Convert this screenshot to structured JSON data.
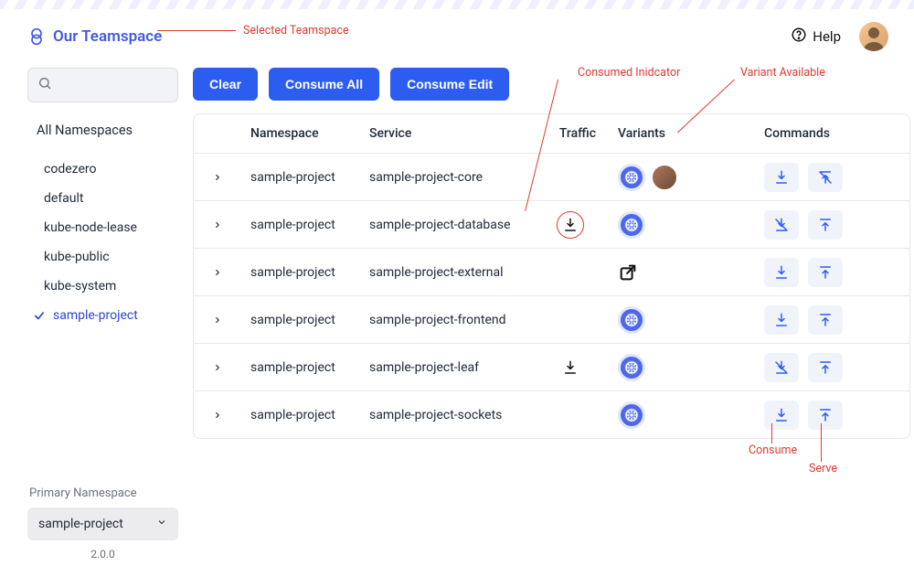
{
  "header": {
    "teamspace_name": "Our Teamspace",
    "help_label": "Help"
  },
  "sidebar": {
    "search_placeholder": "",
    "all_label": "All Namespaces",
    "items": [
      {
        "label": "codezero",
        "selected": false
      },
      {
        "label": "default",
        "selected": false
      },
      {
        "label": "kube-node-lease",
        "selected": false
      },
      {
        "label": "kube-public",
        "selected": false
      },
      {
        "label": "kube-system",
        "selected": false
      },
      {
        "label": "sample-project",
        "selected": true
      }
    ],
    "primary_ns_label": "Primary Namespace",
    "primary_ns_value": "sample-project",
    "version": "2.0.0"
  },
  "toolbar": {
    "clear": "Clear",
    "consume_all": "Consume All",
    "consume_edit": "Consume Edit"
  },
  "columns": {
    "namespace": "Namespace",
    "service": "Service",
    "traffic": "Traffic",
    "variants": "Variants",
    "commands": "Commands"
  },
  "rows": [
    {
      "namespace": "sample-project",
      "service": "sample-project-core",
      "traffic": "none",
      "variant": "wheel+person",
      "cmd1": "download",
      "cmd2": "no-upload"
    },
    {
      "namespace": "sample-project",
      "service": "sample-project-database",
      "traffic": "circled",
      "variant": "wheel",
      "cmd1": "no-download",
      "cmd2": "upload"
    },
    {
      "namespace": "sample-project",
      "service": "sample-project-external",
      "traffic": "none",
      "variant": "external",
      "cmd1": "download",
      "cmd2": "upload"
    },
    {
      "namespace": "sample-project",
      "service": "sample-project-frontend",
      "traffic": "none",
      "variant": "wheel",
      "cmd1": "download",
      "cmd2": "upload"
    },
    {
      "namespace": "sample-project",
      "service": "sample-project-leaf",
      "traffic": "plain",
      "variant": "wheel",
      "cmd1": "no-download",
      "cmd2": "upload"
    },
    {
      "namespace": "sample-project",
      "service": "sample-project-sockets",
      "traffic": "none",
      "variant": "wheel",
      "cmd1": "download",
      "cmd2": "upload"
    }
  ],
  "annotations": {
    "selected_teamspace": "Selected Teamspace",
    "consumed_indicator": "Consumed Inidcator",
    "variant_available": "Variant Available",
    "consume": "Consume",
    "serve": "Serve"
  }
}
